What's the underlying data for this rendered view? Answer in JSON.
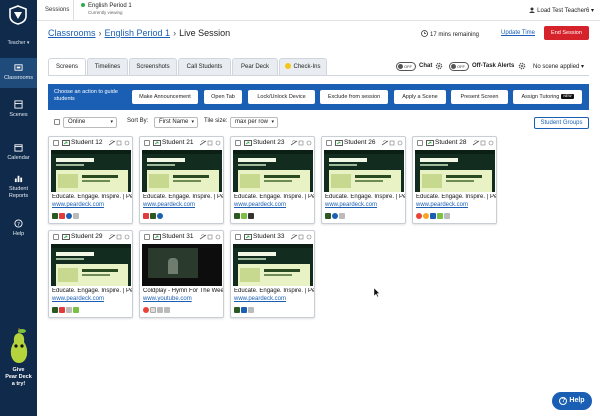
{
  "sidebar": {
    "teacher_label": "Teacher",
    "items": [
      {
        "label": "Classrooms",
        "icon": "classroom-icon",
        "active": true
      },
      {
        "label": "Scenes",
        "icon": "scenes-icon",
        "active": false
      },
      {
        "label": "Calendar",
        "icon": "calendar-icon",
        "active": false
      },
      {
        "label": "Student Reports",
        "icon": "reports-icon",
        "active": false
      },
      {
        "label": "Help",
        "icon": "help-icon",
        "active": false
      }
    ],
    "pear_promo_line1": "Give",
    "pear_promo_line2": "Pear Deck",
    "pear_promo_line3": "a try!"
  },
  "topbar": {
    "sessions_label": "Sessions",
    "period_title": "English Period 1",
    "period_status": "Currently viewing",
    "user_label": "Load Test Teacher6"
  },
  "breadcrumb": {
    "classrooms": "Classrooms",
    "class": "English Period 1",
    "current": "Live Session"
  },
  "session": {
    "timer": "17 mins remaining",
    "update_time": "Update Time",
    "end_session": "End Session"
  },
  "tabs": [
    "Screens",
    "Timelines",
    "Screenshots",
    "Call Students",
    "Pear Deck",
    "Check-Ins"
  ],
  "controls": {
    "chat_toggle": "OFF",
    "chat_label": "Chat",
    "offtask_toggle": "OFF",
    "offtask_label": "Off-Task Alerts",
    "scene": "No scene applied"
  },
  "actions": {
    "lead_line1": "Choose an action to guide",
    "lead_line2": "students",
    "buttons": [
      "Make Announcement",
      "Open Tab",
      "Lock/Unlock Device",
      "Exclude from session",
      "Apply a Scene",
      "Present Screen",
      "Assign Tutoring"
    ],
    "new_badge": "NEW"
  },
  "filters": {
    "status": "Online",
    "sort_label": "Sort By:",
    "sort_value": "First Name",
    "tile_label": "Tile size:",
    "tile_value": "max per row",
    "groups": "Student Groups"
  },
  "students": [
    {
      "name": "Student 12",
      "title": "Educate. Engage. Inspire. | Pe...",
      "url": "www.peardeck.com",
      "kind": "web"
    },
    {
      "name": "Student 21",
      "title": "Educate. Engage. Inspire. | Pe...",
      "url": "www.peardeck.com",
      "kind": "web"
    },
    {
      "name": "Student 23",
      "title": "Educate. Engage. Inspire. | Pe...",
      "url": "www.peardeck.com",
      "kind": "web"
    },
    {
      "name": "Student 26",
      "title": "Educate. Engage. Inspire. | Pe...",
      "url": "www.peardeck.com",
      "kind": "web"
    },
    {
      "name": "Student 28",
      "title": "Educate. Engage. Inspire. | Pe...",
      "url": "www.peardeck.com",
      "kind": "web"
    },
    {
      "name": "Student 29",
      "title": "Educate. Engage. Inspire. | Pe...",
      "url": "www.peardeck.com",
      "kind": "web"
    },
    {
      "name": "Student 31",
      "title": "Coldplay - Hymn For The Wee...",
      "url": "www.youtube.com",
      "kind": "video"
    },
    {
      "name": "Student 33",
      "title": "Educate. Engage. Inspire. | Pe...",
      "url": "www.peardeck.com",
      "kind": "web"
    }
  ],
  "thumb_text": {
    "headline": "Educate. Engage. Inspire.",
    "panel": "Experiences and tools designed with educators"
  },
  "help_button": "Help",
  "colors": {
    "sidebar": "#0f2a4a",
    "primary": "#1a5fb4",
    "danger": "#d6232b"
  }
}
